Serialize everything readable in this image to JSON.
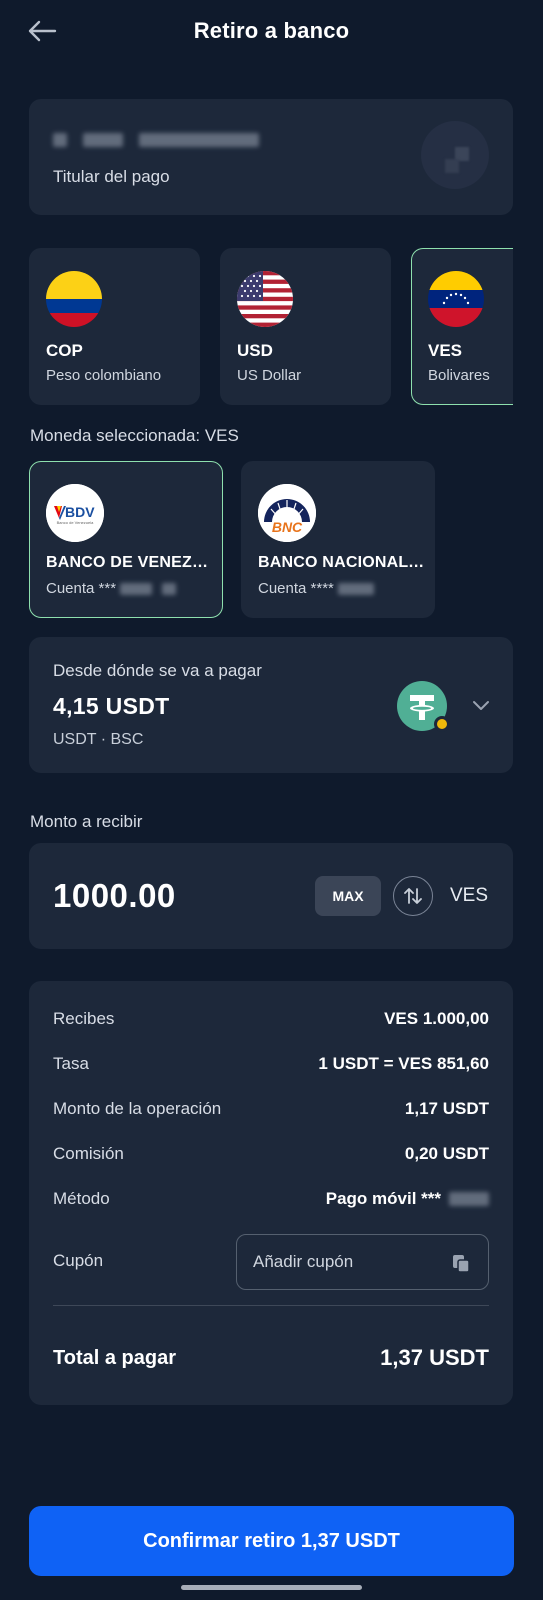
{
  "header": {
    "title": "Retiro a banco"
  },
  "holder": {
    "label": "Titular del pago"
  },
  "currencies": [
    {
      "code": "COP",
      "name": "Peso colombiano",
      "selected": false
    },
    {
      "code": "USD",
      "name": "US Dollar",
      "selected": false
    },
    {
      "code": "VES",
      "name": "Bolivares",
      "selected": true
    }
  ],
  "selected_currency_label": "Moneda seleccionada: VES",
  "banks": [
    {
      "name": "BANCO DE VENEZUELA",
      "account_prefix": "Cuenta ***",
      "selected": true,
      "logo_text": "BDV",
      "logo_subtext": "Banco de Venezuela"
    },
    {
      "name": "BANCO NACIONAL DE CREDITO",
      "account_prefix": "Cuenta ****",
      "selected": false,
      "logo_text": "BNC"
    }
  ],
  "pay_source": {
    "label": "Desde dónde se va a pagar",
    "amount": "4,15 USDT",
    "network": "USDT · BSC"
  },
  "amount_section": {
    "label": "Monto a recibir",
    "value": "1000.00",
    "max_label": "MAX",
    "currency": "VES"
  },
  "summary": {
    "rows": [
      {
        "key": "Recibes",
        "value": "VES 1.000,00"
      },
      {
        "key": "Tasa",
        "value": "1 USDT = VES 851,60"
      },
      {
        "key": "Monto de la operación",
        "value": "1,17 USDT"
      },
      {
        "key": "Comisión",
        "value": "0,20 USDT"
      },
      {
        "key": "Método",
        "value": "Pago móvil ***"
      }
    ],
    "coupon_label": "Cupón",
    "coupon_placeholder": "Añadir cupón",
    "total_label": "Total a pagar",
    "total_value": "1,37 USDT"
  },
  "confirm_button": "Confirmar retiro 1,37 USDT",
  "colors": {
    "background": "#0f1a2c",
    "card": "#1d283a",
    "selected_border": "#8ee0ae",
    "primary_button": "#0f62f5",
    "tether": "#50af95"
  }
}
